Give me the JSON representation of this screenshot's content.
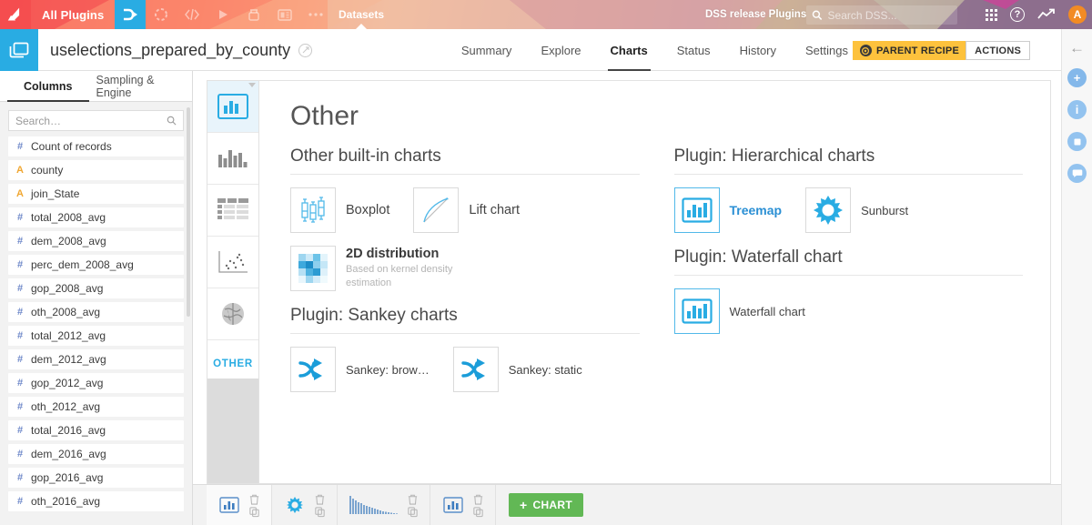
{
  "topbar": {
    "logo_icon": "dataiku-logo-icon",
    "all_plugins_label": "All Plugins",
    "nav_icons": [
      {
        "name": "flow-icon",
        "active": true
      },
      {
        "name": "dataset-circle-icon",
        "active": false
      },
      {
        "name": "code-icon",
        "active": false
      },
      {
        "name": "run-play-icon",
        "active": false
      },
      {
        "name": "lab-icon",
        "active": false
      },
      {
        "name": "dashboard-icon",
        "active": false
      },
      {
        "name": "more-ellipsis-icon",
        "active": false
      }
    ],
    "datasets_label": "Datasets",
    "release_label": "DSS release Plugins",
    "search_placeholder": "Search DSS...",
    "search_value": "",
    "apps_icon": "apps-grid-icon",
    "help_icon": "help-question-icon",
    "activity_icon": "trend-line-icon",
    "avatar_label": "A"
  },
  "objbar": {
    "folder_icon": "dataset-folder-icon",
    "title": "uselections_prepared_by_county",
    "status_icon": "status-circle-icon",
    "tabs": [
      {
        "label": "Summary",
        "active": false
      },
      {
        "label": "Explore",
        "active": false
      },
      {
        "label": "Charts",
        "active": true
      },
      {
        "label": "Status",
        "active": false
      },
      {
        "label": "History",
        "active": false
      },
      {
        "label": "Settings",
        "active": false
      }
    ],
    "parent_recipe_label": "PARENT RECIPE",
    "actions_label": "ACTIONS"
  },
  "rightrail": {
    "back_icon": "back-arrow-icon",
    "items": [
      {
        "name": "add-circle-icon",
        "glyph": "+"
      },
      {
        "name": "info-circle-icon",
        "glyph": "i"
      },
      {
        "name": "details-book-icon",
        "glyph": "■"
      },
      {
        "name": "discussions-chat-icon",
        "glyph": "●"
      }
    ]
  },
  "leftpanel": {
    "tabs": [
      {
        "label": "Columns",
        "active": true
      },
      {
        "label": "Sampling & Engine",
        "active": false
      }
    ],
    "search_placeholder": "Search…",
    "search_value": "",
    "search_icon": "search-icon",
    "columns": [
      {
        "name": "Count of records",
        "type": "#"
      },
      {
        "name": "county",
        "type": "A"
      },
      {
        "name": "join_State",
        "type": "A"
      },
      {
        "name": "total_2008_avg",
        "type": "#"
      },
      {
        "name": "dem_2008_avg",
        "type": "#"
      },
      {
        "name": "perc_dem_2008_avg",
        "type": "#"
      },
      {
        "name": "gop_2008_avg",
        "type": "#"
      },
      {
        "name": "oth_2008_avg",
        "type": "#"
      },
      {
        "name": "total_2012_avg",
        "type": "#"
      },
      {
        "name": "dem_2012_avg",
        "type": "#"
      },
      {
        "name": "gop_2012_avg",
        "type": "#"
      },
      {
        "name": "oth_2012_avg",
        "type": "#"
      },
      {
        "name": "total_2016_avg",
        "type": "#"
      },
      {
        "name": "dem_2016_avg",
        "type": "#"
      },
      {
        "name": "gop_2016_avg",
        "type": "#"
      },
      {
        "name": "oth_2016_avg",
        "type": "#"
      }
    ]
  },
  "typestrip": {
    "items": [
      {
        "name": "basic-charts-icon",
        "selected": true
      },
      {
        "name": "histogram-charts-icon",
        "selected": false
      },
      {
        "name": "table-charts-icon",
        "selected": false
      },
      {
        "name": "scatter-charts-icon",
        "selected": false
      },
      {
        "name": "map-charts-icon",
        "selected": false
      }
    ],
    "other_label": "OTHER"
  },
  "main": {
    "title": "Other",
    "sections": [
      {
        "heading": "Other built-in charts",
        "column": "left",
        "tiles": [
          {
            "label": "Boxplot",
            "icon": "boxplot-icon",
            "sub": "",
            "highlight": false
          },
          {
            "label": "Lift chart",
            "icon": "lift-chart-icon",
            "sub": "",
            "highlight": false
          }
        ],
        "tiles2": [
          {
            "label": "2D distribution",
            "icon": "density-2d-icon",
            "sub": "Based on kernel density estimation",
            "highlight": false
          }
        ]
      },
      {
        "heading": "Plugin: Sankey charts",
        "column": "left",
        "tiles": [
          {
            "label": "Sankey: brow…",
            "icon": "sankey-icon",
            "sub": "",
            "highlight": false
          },
          {
            "label": "Sankey: static",
            "icon": "sankey-icon",
            "sub": "",
            "highlight": false
          }
        ]
      },
      {
        "heading": "Plugin: Hierarchical charts",
        "column": "right",
        "tiles": [
          {
            "label": "Treemap",
            "icon": "treemap-icon",
            "sub": "",
            "highlight": true
          },
          {
            "label": "Sunburst",
            "icon": "sunburst-icon",
            "sub": "",
            "highlight": false
          }
        ]
      },
      {
        "heading": "Plugin: Waterfall chart",
        "column": "right",
        "tiles": [
          {
            "label": "Waterfall chart",
            "icon": "waterfall-icon",
            "sub": "",
            "highlight": false
          }
        ]
      }
    ]
  },
  "bottombar": {
    "chips": [
      {
        "thumb": "bar-chart-thumb",
        "selected": true
      },
      {
        "thumb": "sunburst-thumb",
        "selected": false
      },
      {
        "thumb": "histogram-thumb",
        "selected": false
      },
      {
        "thumb": "bar-chart-thumb",
        "selected": false
      }
    ],
    "delete_icon": "trash-icon",
    "copy_icon": "copy-icon",
    "add_chart_label": "CHART",
    "add_chart_plus": "+",
    "add_chart_color": "#62b855"
  },
  "colors": {
    "accent_blue": "#29ace3",
    "brand_coral": "#f86d63",
    "warning_yellow": "#fdc23d",
    "success_green": "#62b855",
    "link_blue": "#2a8fd4"
  }
}
